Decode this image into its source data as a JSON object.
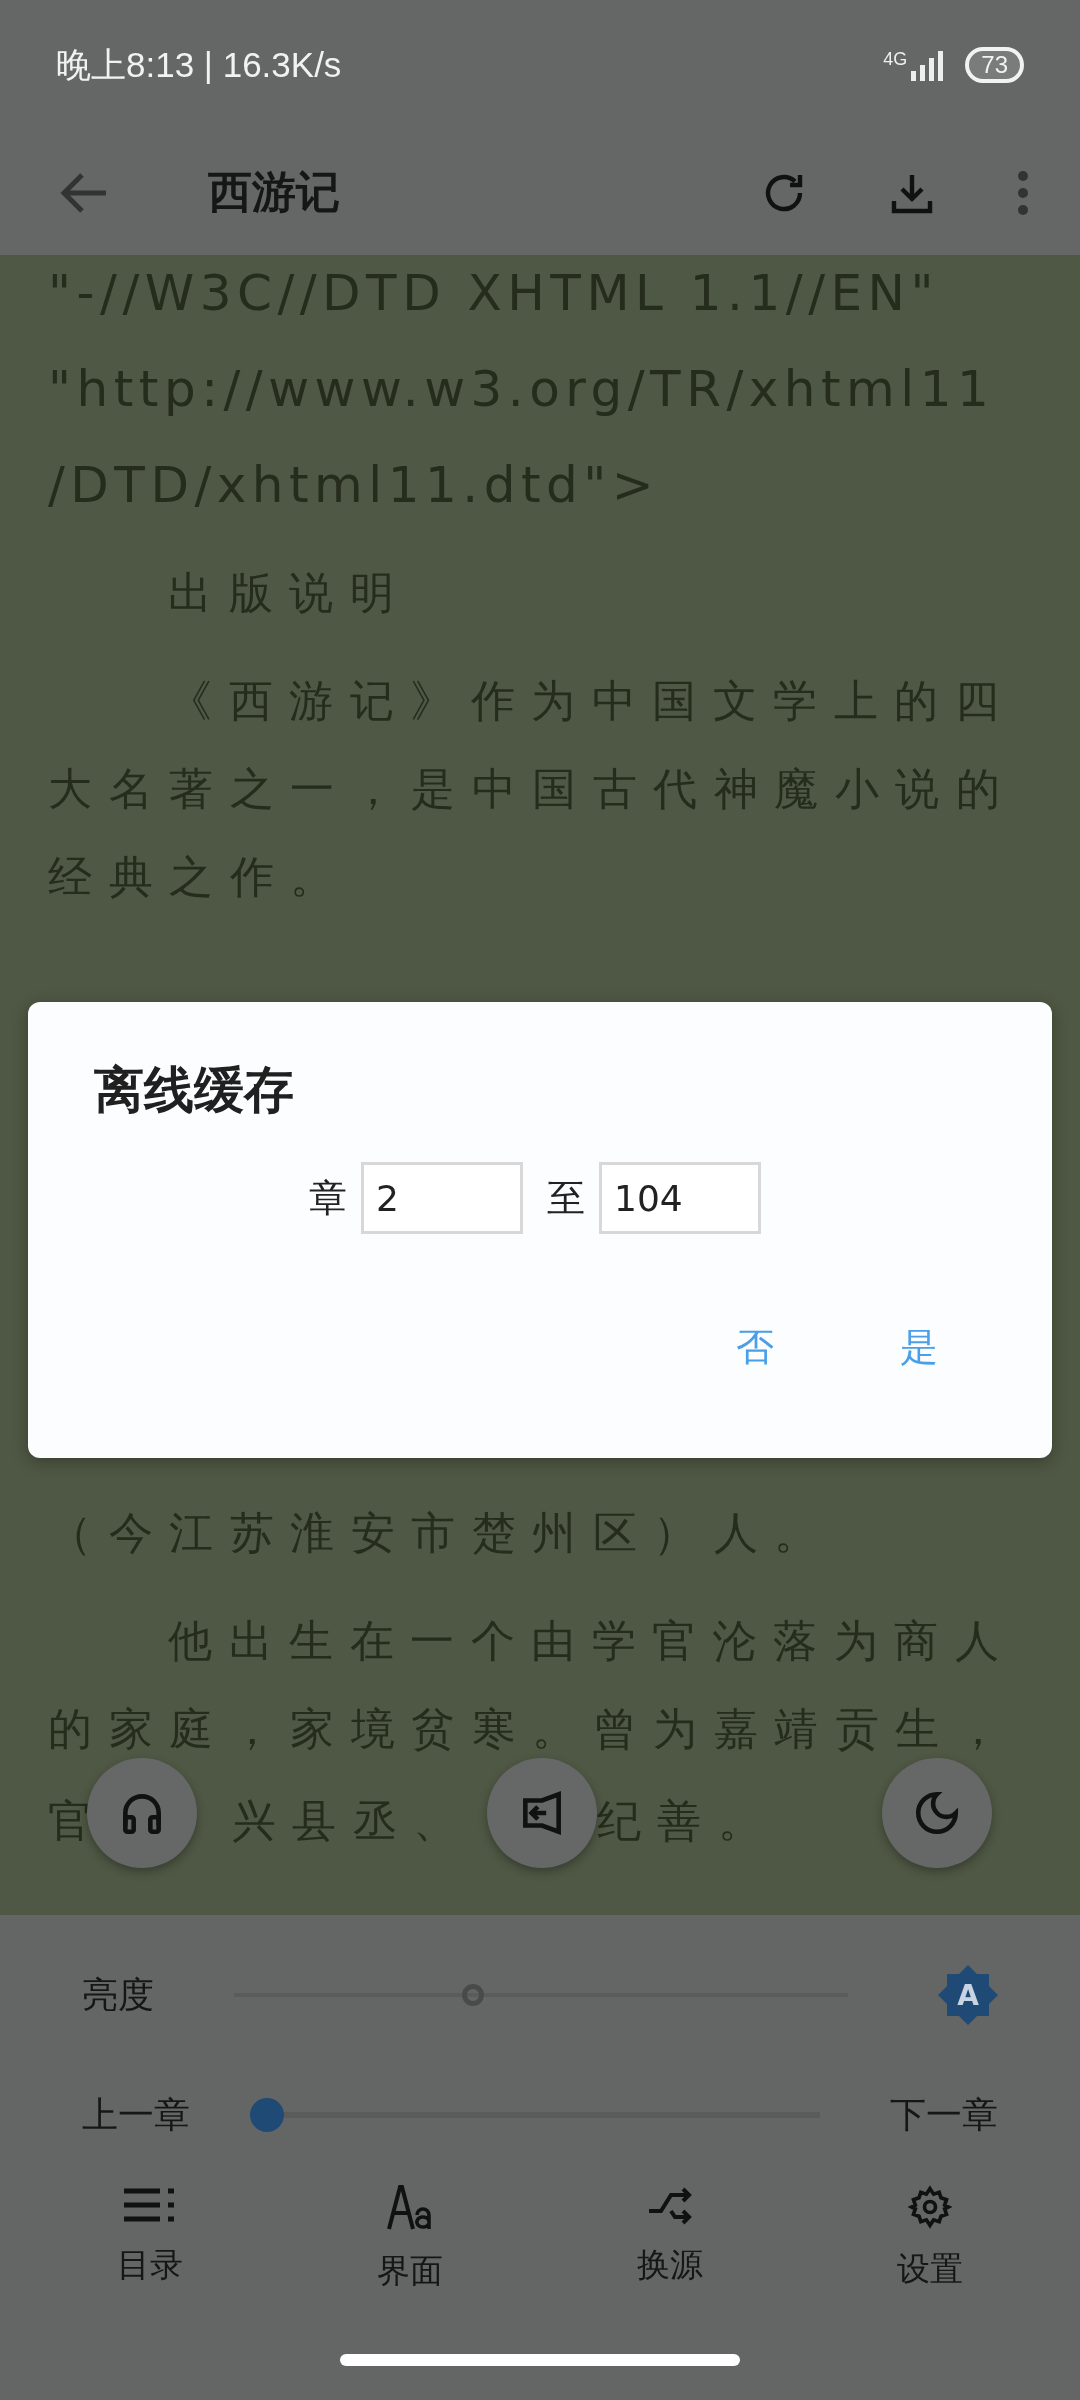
{
  "status_bar": {
    "time_speed": "晚上8:13 | 16.3K/s",
    "network": "4G",
    "battery": "73"
  },
  "toolbar": {
    "title": "西游记"
  },
  "reader_lines": [
    {
      "kind": "code",
      "text": "\"-//W3C//DTD XHTML 1.1//EN\""
    },
    {
      "kind": "code",
      "text": "\"http://www.w3.org/TR/xhtml11"
    },
    {
      "kind": "code",
      "text": "/DTD/xhtml11.dtd\">"
    },
    {
      "kind": "para",
      "text": "出版说明"
    },
    {
      "kind": "para",
      "text": "《西游记》作为中国文学上的四"
    },
    {
      "kind": "text",
      "text": "大名著之一，是中国古代神魔小说的"
    },
    {
      "kind": "text",
      "text": "经典之作。"
    }
  ],
  "reader_lines_after": [
    {
      "kind": "text",
      "text": "（今江苏淮安市楚州区）人。"
    },
    {
      "kind": "para",
      "text": "他出生在一个由学官沦落为商人"
    },
    {
      "kind": "text",
      "text": "的家庭，家境贫寒。曾为嘉靖贡生，"
    },
    {
      "kind": "covered",
      "parts": [
        "官",
        "兴县丞、",
        "纪善。"
      ]
    }
  ],
  "dialog": {
    "title": "离线缓存",
    "from_label": "章",
    "from_value": "2",
    "to_label": "至",
    "to_value": "104",
    "buttons": [
      "否",
      "是"
    ]
  },
  "panel": {
    "brightness_label": "亮度",
    "brightness": {
      "level": 0.39
    },
    "auto_brightness": {
      "label": "A",
      "on": true
    },
    "prev_chapter": "上一章",
    "chapter": {
      "level": 0.03
    },
    "next_chapter": "下一章",
    "nav": [
      {
        "kind": "toc",
        "label": "目录"
      },
      {
        "kind": "font",
        "label": "界面"
      },
      {
        "kind": "source",
        "label": "换源"
      },
      {
        "kind": "settings",
        "label": "设置"
      }
    ]
  }
}
